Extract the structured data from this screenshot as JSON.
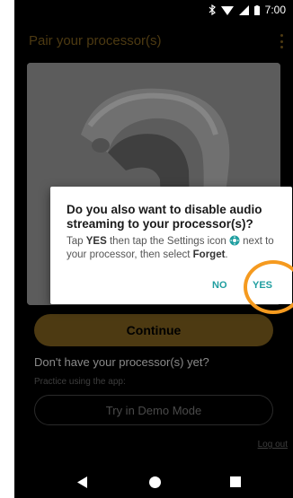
{
  "status_bar": {
    "time": "7:00"
  },
  "app_bar": {
    "title": "Pair your processor(s)"
  },
  "main": {
    "continue_label": "Continue",
    "no_processor_text": "Don't have your processor(s) yet?",
    "practice_text": "Practice using the app:",
    "demo_label": "Try in Demo Mode",
    "logout_label": "Log out"
  },
  "dialog": {
    "title": "Do you also want to disable audio streaming to your processor(s)?",
    "body_1": "Tap ",
    "body_yes": "YES",
    "body_2": " then tap the Settings icon ",
    "body_3": " next to your processor, then select ",
    "body_forget": "Forget",
    "body_4": ".",
    "no_label": "NO",
    "yes_label": "YES"
  },
  "colors": {
    "accent": "#1f9ea0",
    "highlight": "#f59a1f",
    "dim_gold": "#4d3a12"
  }
}
